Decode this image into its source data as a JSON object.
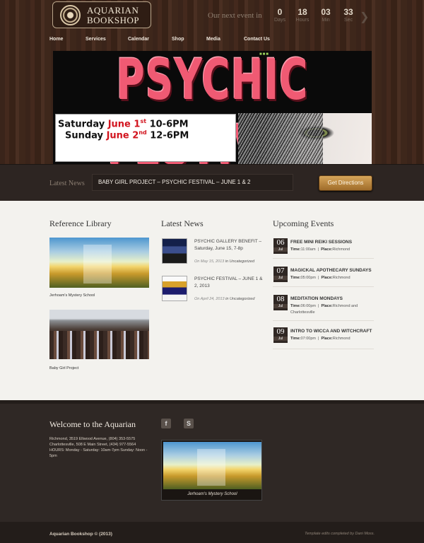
{
  "header": {
    "logo_line1": "AQUARIAN",
    "logo_line2": "BOOKSHOP",
    "event_label": "Our next event in",
    "countdown": [
      {
        "value": "0",
        "unit": "Days"
      },
      {
        "value": "18",
        "unit": "Hours"
      },
      {
        "value": "03",
        "unit": "Min"
      },
      {
        "value": "33",
        "unit": "Sec"
      }
    ]
  },
  "nav": [
    "Home",
    "Services",
    "Calendar",
    "Shop",
    "Media",
    "Contact Us"
  ],
  "banner": {
    "title": "PSYCHIC FESTIVAL",
    "line1_day": "Saturday",
    "line1_month": "June 1",
    "line1_sup": "st",
    "line1_time": "10-6PM",
    "line2_day": "Sunday",
    "line2_month": "June 2",
    "line2_sup": "nd",
    "line2_time": "12-6PM"
  },
  "newsbar": {
    "label": "Latest News",
    "ticker": "BABY GIRL PROJECT – PSYCHIC FESTIVAL – JUNE 1 & 2",
    "button": "Get Directions"
  },
  "reference": {
    "title": "Reference Library",
    "items": [
      "Jerhoam's Mystery School",
      "Baby Girl Project"
    ]
  },
  "latest_news": {
    "title": "Latest News",
    "items": [
      {
        "title": "PSYCHIC GALLERY BENEFIT – Saturday, June 15, 7-8p",
        "date": "On May 15, 2013",
        "category": "in Uncategorized"
      },
      {
        "title": "PSYCHIC FESTIVAL – JUNE 1 & 2, 2013",
        "date": "On April 24, 2013",
        "category": "in Uncategorized"
      }
    ]
  },
  "events": {
    "title": "Upcoming Events",
    "time_label": "Time:",
    "place_label": "Place:",
    "items": [
      {
        "day": "06",
        "month": "Jul",
        "title": "FREE MINI REIKI SESSIONS",
        "time": "11:00am",
        "place": "Richmond"
      },
      {
        "day": "07",
        "month": "Jul",
        "title": "MAGICKAL APOTHECARY SUNDAYS",
        "time": "05:00pm",
        "place": "Richmond"
      },
      {
        "day": "08",
        "month": "Jul",
        "title": "MEDITATION MONDAYS",
        "time": "06:00pm",
        "place": "Richmond and Charlottesville"
      },
      {
        "day": "09",
        "month": "Jul",
        "title": "INTRO TO WICCA AND WITCHCRAFT",
        "time": "07:00pm",
        "place": "Richmond"
      }
    ]
  },
  "footer": {
    "title": "Welcome to the Aquarian",
    "address1": "Richmond, 3519 Ellwood Avenue, (804) 353-5575",
    "address2": "Charlottesville, 508 E Main Street, (434) 977-5564",
    "hours": "HOURS: Monday - Saturday: 10am-7pm Sunday: Noon - 5pm",
    "photo_caption": "Jerhoam's Mystery School",
    "copyright": "Aquarian Bookshop © (2013)",
    "credit": "Template edits completed by Dani Moss."
  },
  "colors": {
    "accent": "#d6a55a",
    "banner_pink": "#f05a73",
    "footer_bg": "#2f2825"
  }
}
